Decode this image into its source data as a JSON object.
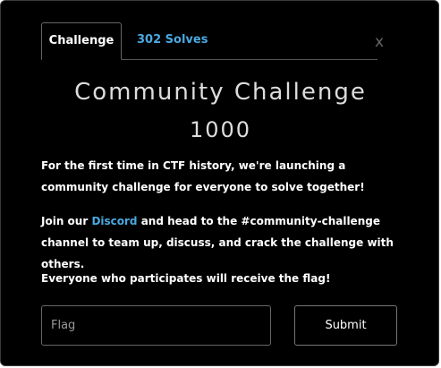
{
  "tabs": [
    {
      "label": "Challenge"
    },
    {
      "label": "302 Solves"
    }
  ],
  "close_label": "x",
  "challenge": {
    "title": "Community Challenge",
    "points": "1000"
  },
  "description": {
    "p1": "For the first time in CTF history, we're launching a community challenge for everyone to solve together!",
    "p2_before": "Join our ",
    "p2_link": "Discord",
    "p2_after": " and head to the #community-challenge channel to team up, discuss, and crack the challenge with others.",
    "p3": "Everyone who participates will receive the flag!"
  },
  "form": {
    "flag_placeholder": "Flag",
    "submit_label": "Submit"
  },
  "colors": {
    "background": "#000000",
    "link": "#4aa8e0",
    "text": "#ffffff"
  }
}
